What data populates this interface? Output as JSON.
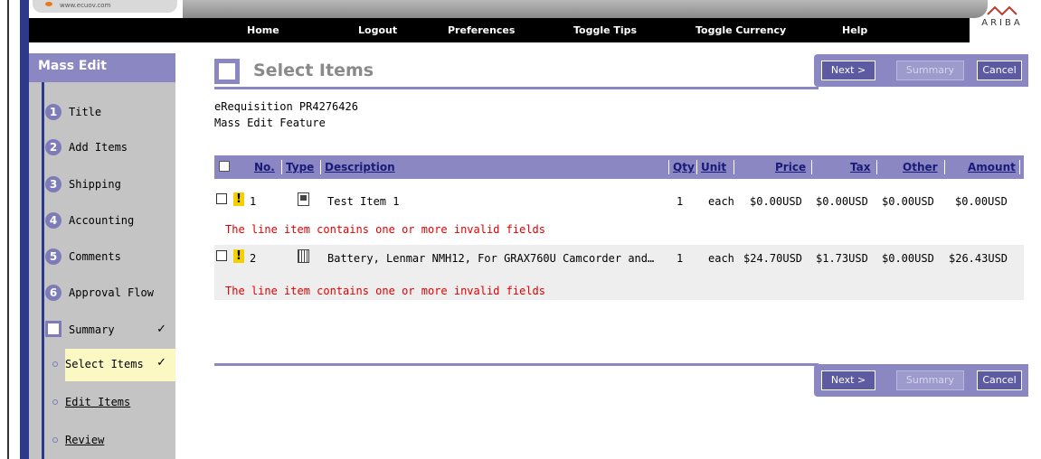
{
  "browser": {
    "url": "www.ecuov.com"
  },
  "nav": {
    "items": [
      "Home",
      "Logout",
      "Preferences",
      "Toggle Tips",
      "Toggle Currency",
      "Help"
    ],
    "logo_text": "ARIBA"
  },
  "sidebar": {
    "title": "Mass Edit",
    "steps": [
      {
        "num": "1",
        "label": "Title"
      },
      {
        "num": "2",
        "label": "Add Items"
      },
      {
        "num": "3",
        "label": "Shipping"
      },
      {
        "num": "4",
        "label": "Accounting"
      },
      {
        "num": "5",
        "label": "Comments"
      },
      {
        "num": "6",
        "label": "Approval Flow"
      }
    ],
    "summary": {
      "label": "Summary",
      "check": "✓"
    },
    "substeps": [
      {
        "label": "Select Items",
        "check": "✓"
      },
      {
        "label": "Edit Items"
      },
      {
        "label": "Review"
      }
    ]
  },
  "page": {
    "title": "Select Items",
    "requisition": "eRequisition PR4276426",
    "feature": "Mass Edit Feature"
  },
  "buttons": {
    "next": "Next >",
    "summary": "Summary",
    "cancel": "Cancel"
  },
  "table": {
    "headers": {
      "no": "No.",
      "type": "Type",
      "description": "Description",
      "qty": "Qty",
      "unit": "Unit",
      "price": "Price",
      "tax": "Tax",
      "other": "Other",
      "amount": "Amount"
    },
    "rows": [
      {
        "warn": "!",
        "no": "1",
        "description": "Test Item 1",
        "qty": "1",
        "unit": "each",
        "price": "$0.00USD",
        "tax": "$0.00USD",
        "other": "$0.00USD",
        "amount": "$0.00USD",
        "error": "The line item contains one or more invalid fields"
      },
      {
        "warn": "!",
        "no": "2",
        "description": "Battery, Lenmar NMH12, For GRAX760U Camcorder and…",
        "qty": "1",
        "unit": "each",
        "price": "$24.70USD",
        "tax": "$1.73USD",
        "other": "$0.00USD",
        "amount": "$26.43USD",
        "error": "The line item contains one or more invalid fields"
      }
    ]
  },
  "colors": {
    "accent": "#8a87c2",
    "nav_bg": "#000000",
    "sidebar_bg": "#c4c4c4",
    "error": "#e00000",
    "active_step": "#fbf8c4"
  }
}
